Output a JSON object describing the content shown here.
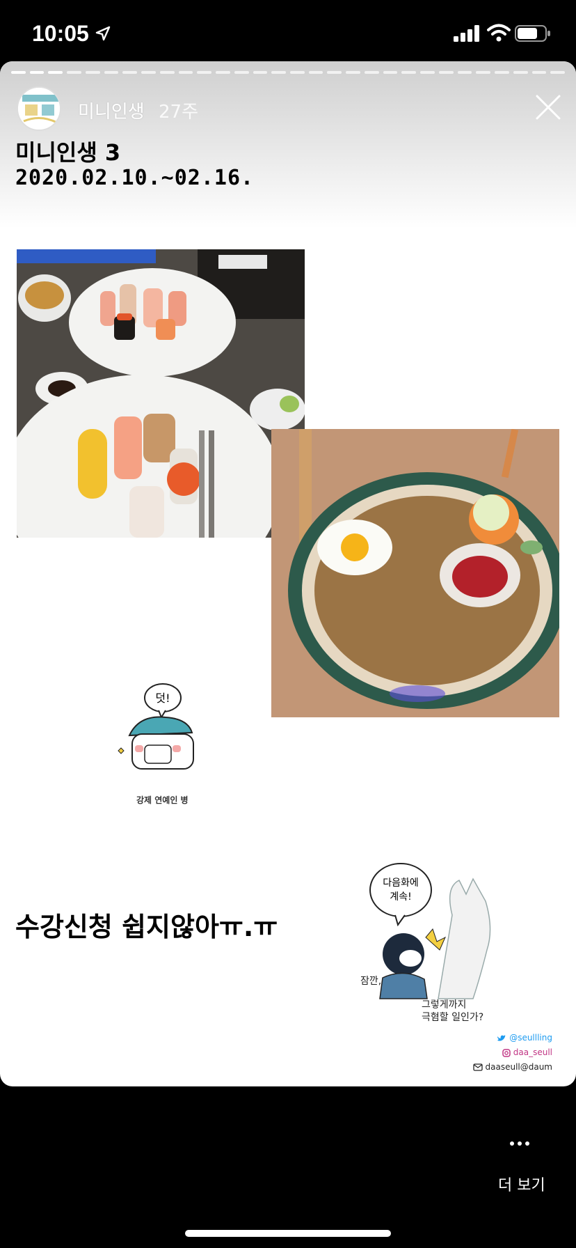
{
  "status_bar": {
    "time": "10:05"
  },
  "story": {
    "account_name": "미니인생",
    "posted_ago": "27주",
    "title": "미니인생  3",
    "date_range": "2020.02.10.~02.16.",
    "progress": {
      "segments": 30,
      "completed": 3
    },
    "sticker": {
      "bubble": "덧!",
      "caption": "강제 연예인 병"
    },
    "caption": "수강신청  쉽지않아ㅠ.ㅠ",
    "cartoon": {
      "bubble_line1": "다음화에",
      "bubble_line2": "계속!",
      "wait": "잠깐,",
      "line1": "그렇게까지",
      "line2": "극혐할 일인가?"
    },
    "credits": {
      "twitter": "@seullling",
      "instagram": "daa_seull",
      "email": "daaseull@daum"
    }
  },
  "footer": {
    "more_label": "더 보기"
  },
  "colors": {
    "twitter": "#1d9bf0",
    "instagram": "#c13584",
    "accent_teal": "#4aa7b4"
  }
}
